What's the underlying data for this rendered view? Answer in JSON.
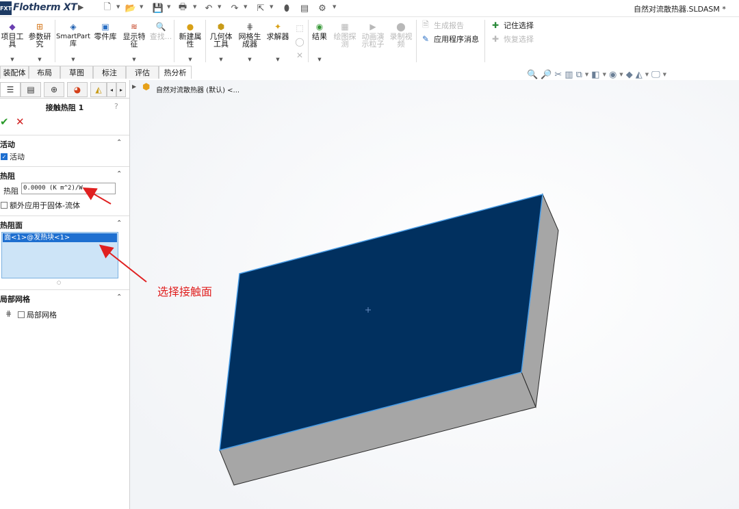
{
  "titlebar": {
    "logo": "FXT",
    "app_name": "Flotherm XT",
    "document_title": "自然对流散热器.SLDASM *",
    "quick_icons": [
      "new-file-icon",
      "open-file-icon",
      "save-icon",
      "print-icon",
      "undo-icon",
      "redo-icon",
      "select-icon",
      "rebuild-icon",
      "file-properties-icon",
      "options-gear-icon"
    ]
  },
  "ribbon": {
    "buttons": [
      {
        "id": "project-tools",
        "label": "项目工\n具",
        "icon": "project-icon",
        "dropdown": true
      },
      {
        "id": "parametric-study",
        "label": "参数研\n究",
        "icon": "grid-icon",
        "dropdown": true
      },
      {
        "id": "smartpart-library",
        "label": "SmartPart\n库",
        "icon": "smartpart-icon",
        "dropdown": true
      },
      {
        "id": "parts-library",
        "label": "零件库",
        "icon": "parts-icon",
        "dropdown": false
      },
      {
        "id": "show-features",
        "label": "显示特\n征",
        "icon": "features-icon",
        "dropdown": true
      },
      {
        "id": "find",
        "label": "查找...",
        "icon": "find-icon",
        "dropdown": false,
        "disabled": true
      },
      {
        "id": "new-attribute",
        "label": "新建属\n性",
        "icon": "attribute-icon",
        "dropdown": true
      },
      {
        "id": "geometry-tools",
        "label": "几何体\n工具",
        "icon": "geometry-icon",
        "dropdown": true
      },
      {
        "id": "mesh-generator",
        "label": "网格生\n成器",
        "icon": "mesh-icon",
        "dropdown": true
      },
      {
        "id": "solver",
        "label": "求解器",
        "icon": "solver-icon",
        "dropdown": true
      },
      {
        "id": "results",
        "label": "结果",
        "icon": "results-icon",
        "dropdown": true
      },
      {
        "id": "plot-probe",
        "label": "绘图探\n测",
        "icon": "probe-icon",
        "dropdown": false,
        "disabled": true
      },
      {
        "id": "animate-particles",
        "label": "动画演\n示粒子",
        "icon": "animate-icon",
        "dropdown": false,
        "disabled": true
      },
      {
        "id": "record-video",
        "label": "录制视\n频",
        "icon": "record-icon",
        "dropdown": false,
        "disabled": true
      }
    ],
    "right_rows": [
      {
        "id": "generate-report",
        "label": "生成报告",
        "icon": "report-icon",
        "disabled": true
      },
      {
        "id": "app-messages",
        "label": "应用程序消息",
        "icon": "messages-icon",
        "disabled": false
      },
      {
        "id": "remember-selection",
        "label": "记住选择",
        "icon": "remember-icon",
        "disabled": false
      },
      {
        "id": "restore-selection",
        "label": "恢复选择",
        "icon": "restore-icon",
        "disabled": true
      }
    ]
  },
  "tabs": [
    "装配体",
    "布局",
    "草图",
    "标注",
    "评估",
    "热分析"
  ],
  "active_tab": "热分析",
  "view_tools": [
    "zoom-fit-icon",
    "zoom-area-icon",
    "previous-view-icon",
    "section-view-icon",
    "view-orientation-icon",
    "display-style-icon",
    "hide-show-icon",
    "appearance-icon",
    "scene-icon",
    "display-settings-icon"
  ],
  "panel": {
    "feature_title": "接触热阻 1",
    "help": "?",
    "ok": "✔",
    "cancel": "✕",
    "section_active": {
      "title": "活动",
      "checkbox_label": "活动",
      "checked": true
    },
    "section_resistance": {
      "title": "热阻",
      "field_label": "热阻",
      "value": "0.0000 (K m^2)/W",
      "extra_label": "额外应用于固体-流体",
      "extra_checked": false
    },
    "section_faces": {
      "title": "热阻面",
      "selected_face": "面<1>@发热块<1>"
    },
    "section_mesh": {
      "title": "局部网格",
      "checkbox_label": "局部网格",
      "checked": false
    }
  },
  "viewport": {
    "tree_label": "自然对流散热器 (默认) <...",
    "annotation": "选择接触面",
    "colors": {
      "top_face": "#01305f",
      "edge_highlight": "#4a9ee8",
      "side_face": "#a6a6a6",
      "annotation": "#e02020"
    }
  }
}
